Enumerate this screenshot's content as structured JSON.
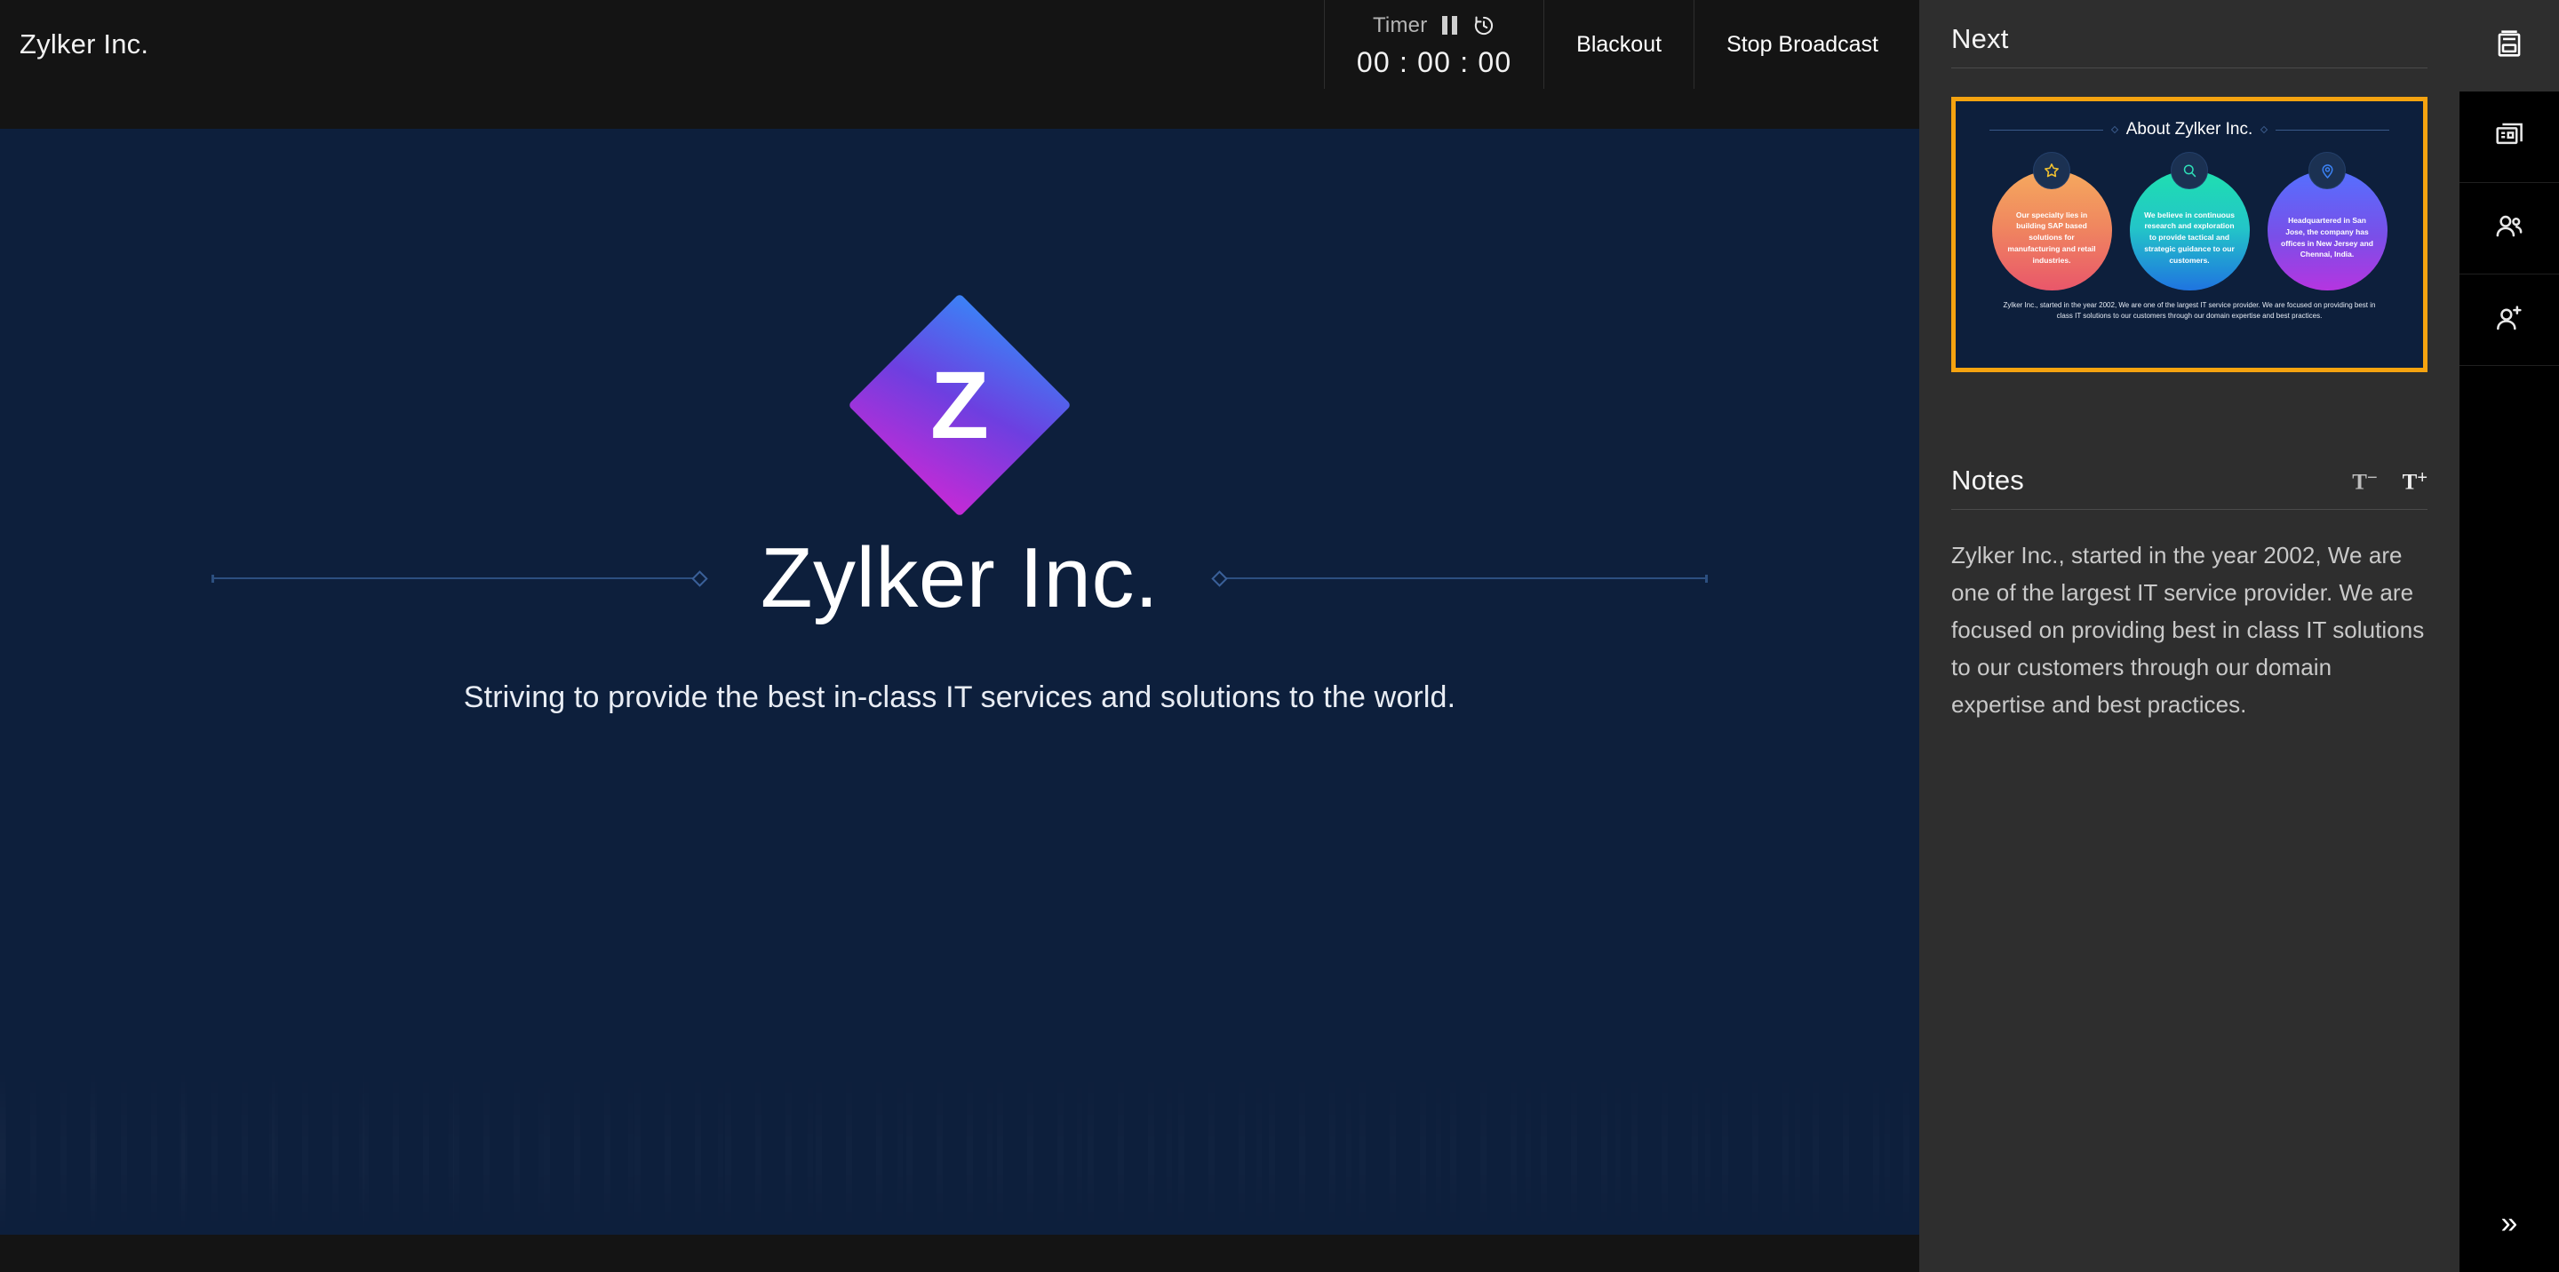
{
  "header": {
    "title": "Zylker Inc.",
    "timer": {
      "label": "Timer",
      "value": "00 : 00 : 00",
      "pause_icon": "pause-icon",
      "reset_icon": "reset-timer-icon"
    },
    "blackout_label": "Blackout",
    "stop_broadcast_label": "Stop Broadcast"
  },
  "slide": {
    "logo_letter": "Z",
    "title": "Zylker Inc.",
    "subtitle": "Striving to provide the best in-class IT services and solutions to the world."
  },
  "panel": {
    "next_label": "Next",
    "notes_label": "Notes",
    "font_decrease_label": "T",
    "font_decrease_sign": "−",
    "font_increase_label": "T",
    "font_increase_sign": "+",
    "notes_text": "Zylker Inc., started in the year 2002, We are one of the largest IT service provider. We are focused on providing best in class IT solutions to our customers through our domain expertise and best practices.",
    "next_slide": {
      "title": "About Zylker Inc.",
      "circles": [
        {
          "icon": "star-icon",
          "text": "Our specialty lies in building SAP based solutions for manufacturing and retail industries.",
          "gradient": [
            "#f5a95e",
            "#e9576a"
          ]
        },
        {
          "icon": "search-icon",
          "text": "We believe in continuous research and exploration to provide tactical and strategic guidance to our customers.",
          "gradient": [
            "#1fdfb0",
            "#1f74e0"
          ]
        },
        {
          "icon": "location-pin-icon",
          "text": "Headquartered in San Jose, the company has offices in New Jersey and Chennai, India.",
          "gradient": [
            "#5470ff",
            "#b535e0"
          ]
        }
      ],
      "footer": "Zylker Inc., started in the year 2002, We are one of the largest IT service provider. We are focused on providing best in class IT solutions to our customers through our domain expertise and best practices."
    }
  },
  "rail": {
    "items": [
      {
        "icon": "notes-panel-icon",
        "active": true
      },
      {
        "icon": "slides-layout-icon",
        "active": false
      },
      {
        "icon": "attendees-icon",
        "active": false
      },
      {
        "icon": "invite-person-icon",
        "active": false
      }
    ],
    "collapse_icon": "chevron-double-right-icon",
    "collapse_glyph": "»"
  },
  "colors": {
    "accent_orange": "#f5a310",
    "slide_bg": "#0d1f3c",
    "panel_bg": "#2e2e2e",
    "topbar_bg": "#141414",
    "rail_bg": "#000000"
  }
}
